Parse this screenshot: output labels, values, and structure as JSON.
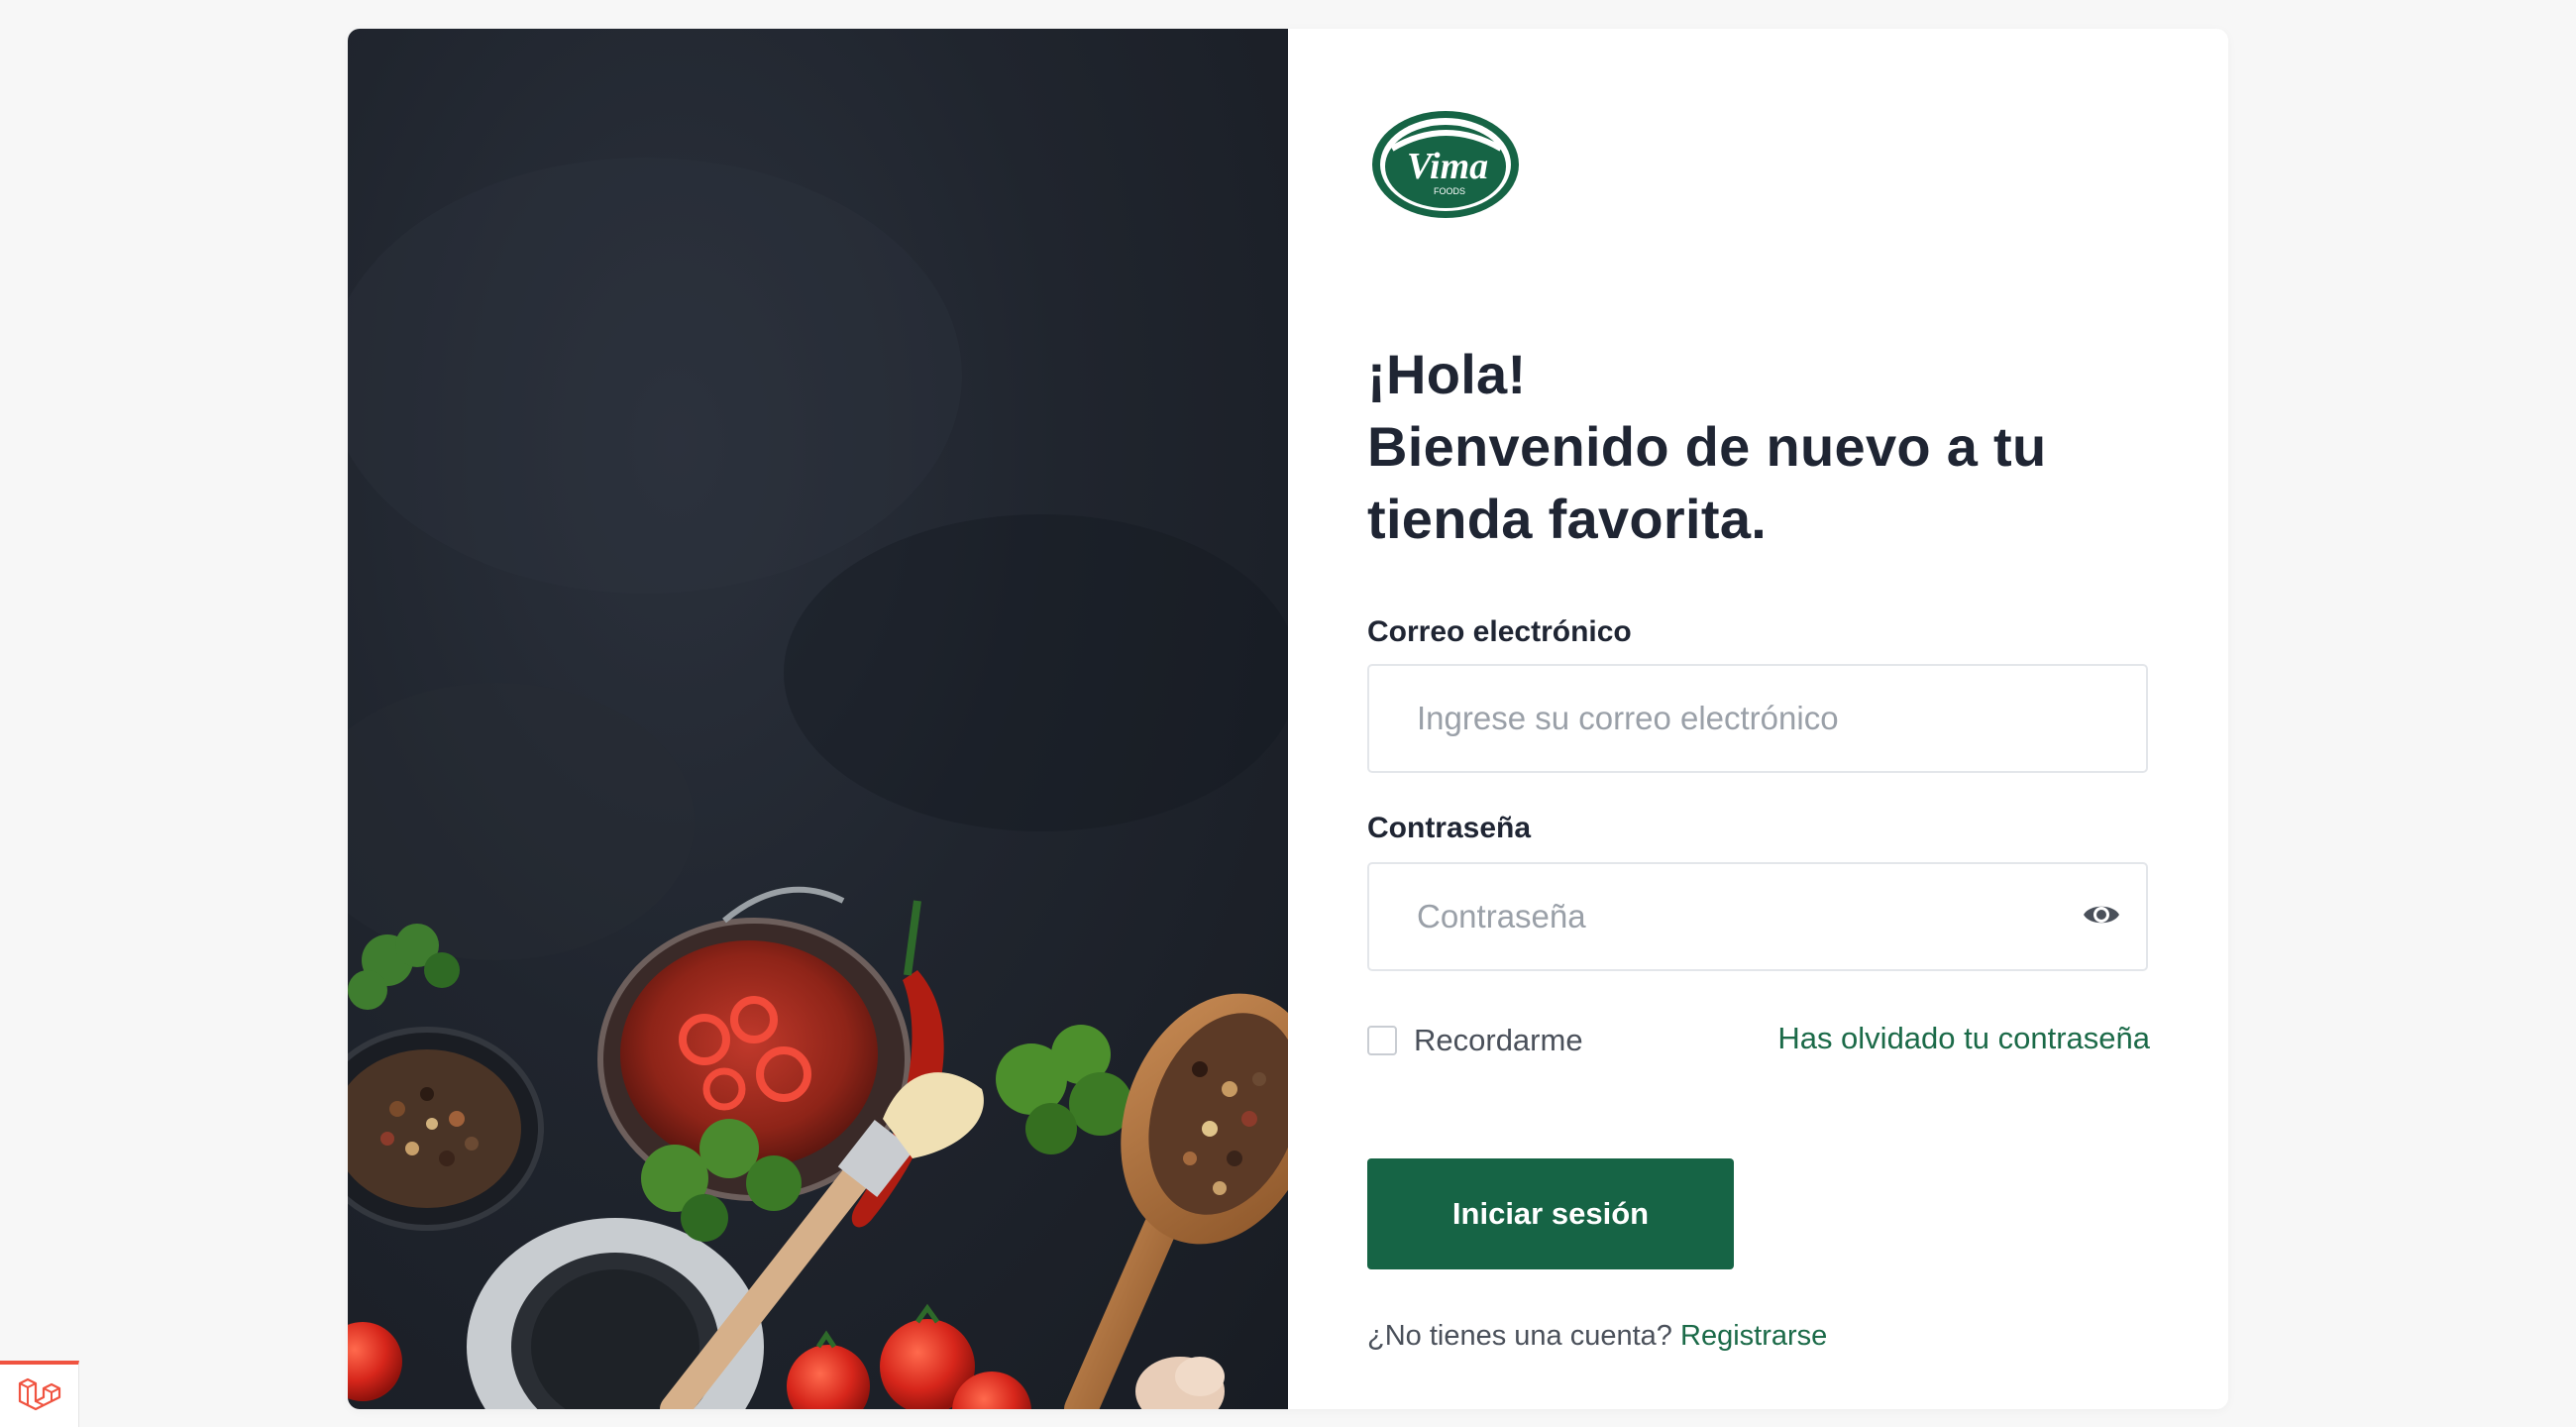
{
  "app": {
    "brand_name": "Vima",
    "brand_sub": "FOODS",
    "brand_color": "#166445"
  },
  "hero": {
    "image": "dark-slate-food-photo",
    "icons": [
      "tomato-icon",
      "chili-pepper-icon",
      "parsley-icon",
      "pepper-spoon-icon",
      "basting-brush-icon",
      "sauce-jar-icon"
    ]
  },
  "greeting": {
    "line1": "¡Hola!",
    "line2": "Bienvenido de nuevo a tu",
    "line3": "tienda favorita."
  },
  "form": {
    "email_label": "Correo electrónico",
    "email_placeholder": "Ingrese su correo electrónico",
    "email_value": "",
    "password_label": "Contraseña",
    "password_placeholder": "Contraseña",
    "password_value": "",
    "remember_label": "Recordarme",
    "remember_checked": false,
    "forgot_label": "Has olvidado tu contraseña",
    "submit_label": "Iniciar sesión",
    "no_account_text": "¿No tienes una cuenta?",
    "register_label": "Registrarse"
  },
  "colors": {
    "accent": "#166445",
    "link": "#1b6a48",
    "text": "#1f2533",
    "muted": "#9aa0a8",
    "border": "#e3e6ea",
    "laravel": "#f05340"
  },
  "debug_badge": {
    "icon": "laravel-icon"
  }
}
